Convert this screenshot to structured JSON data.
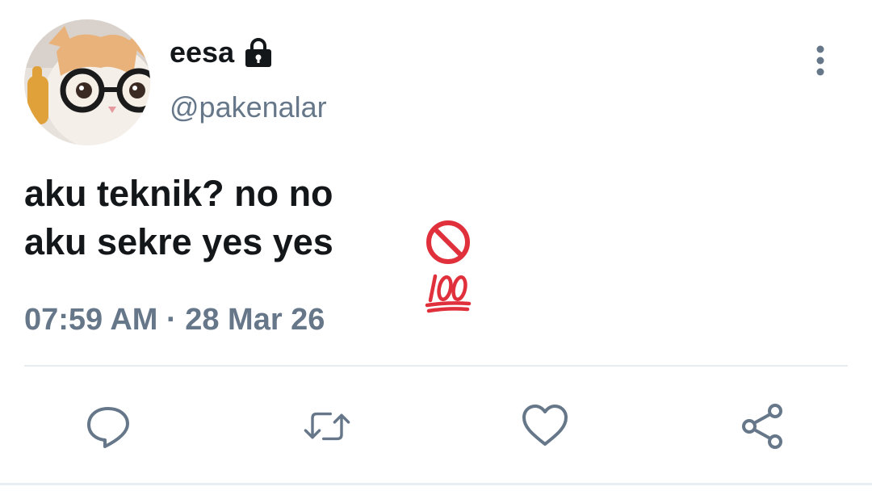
{
  "user": {
    "display_name": "eesa",
    "handle": "@pakenalar",
    "avatar": "cat-with-glasses",
    "protected_icon": "lock-icon"
  },
  "tweet": {
    "lines": [
      {
        "text": "aku teknik? no no",
        "emoji": "no-entry-emoji"
      },
      {
        "text": "aku sekre yes yes",
        "emoji": "hundred-points-emoji"
      }
    ],
    "time": "07:59 AM",
    "separator": " · ",
    "date": "28 Mar 26"
  },
  "actions": [
    {
      "icon": "reply-icon"
    },
    {
      "icon": "retweet-icon"
    },
    {
      "icon": "like-icon"
    },
    {
      "icon": "share-icon"
    }
  ],
  "colors": {
    "text": "#14171a",
    "secondary": "#66778a",
    "divider": "#e6ecf0",
    "no_entry_red": "#e0303c",
    "hundred_red": "#e0303c"
  }
}
